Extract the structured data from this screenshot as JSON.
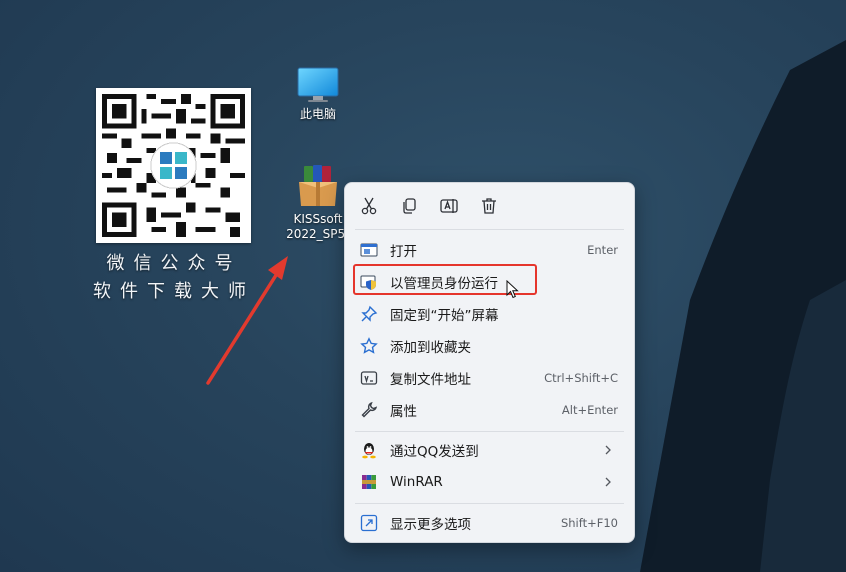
{
  "desktop": {
    "qr_caption_line1": "微信公众号",
    "qr_caption_line2": "软件下载大师",
    "icons": [
      {
        "label": "此电脑",
        "icon": "monitor-icon"
      },
      {
        "label_line1": "KISSsoft",
        "label_line2": "2022_SP5(",
        "icon": "winrar-archive-icon"
      }
    ]
  },
  "context_menu": {
    "toolbar": [
      {
        "icon": "cut-icon"
      },
      {
        "icon": "copy-icon"
      },
      {
        "icon": "rename-icon"
      },
      {
        "icon": "delete-icon"
      }
    ],
    "items": [
      {
        "label": "打开",
        "shortcut": "Enter",
        "icon": "open-icon"
      },
      {
        "label": "以管理员身份运行",
        "shortcut": "",
        "icon": "shield-icon",
        "highlighted": true
      },
      {
        "label": "固定到“开始”屏幕",
        "shortcut": "",
        "icon": "pin-icon"
      },
      {
        "label": "添加到收藏夹",
        "shortcut": "",
        "icon": "star-icon"
      },
      {
        "label": "复制文件地址",
        "shortcut": "Ctrl+Shift+C",
        "icon": "copy-path-icon"
      },
      {
        "label": "属性",
        "shortcut": "Alt+Enter",
        "icon": "wrench-icon"
      },
      {
        "label": "通过QQ发送到",
        "shortcut": "",
        "icon": "qq-icon",
        "submenu": true
      },
      {
        "label": "WinRAR",
        "shortcut": "",
        "icon": "winrar-icon",
        "submenu": true
      },
      {
        "label": "显示更多选项",
        "shortcut": "Shift+F10",
        "icon": "more-options-icon"
      }
    ]
  },
  "colors": {
    "highlight_box": "#e5352c",
    "annotation_arrow": "#e23a2e",
    "menu_bg": "#f1f3f6"
  }
}
